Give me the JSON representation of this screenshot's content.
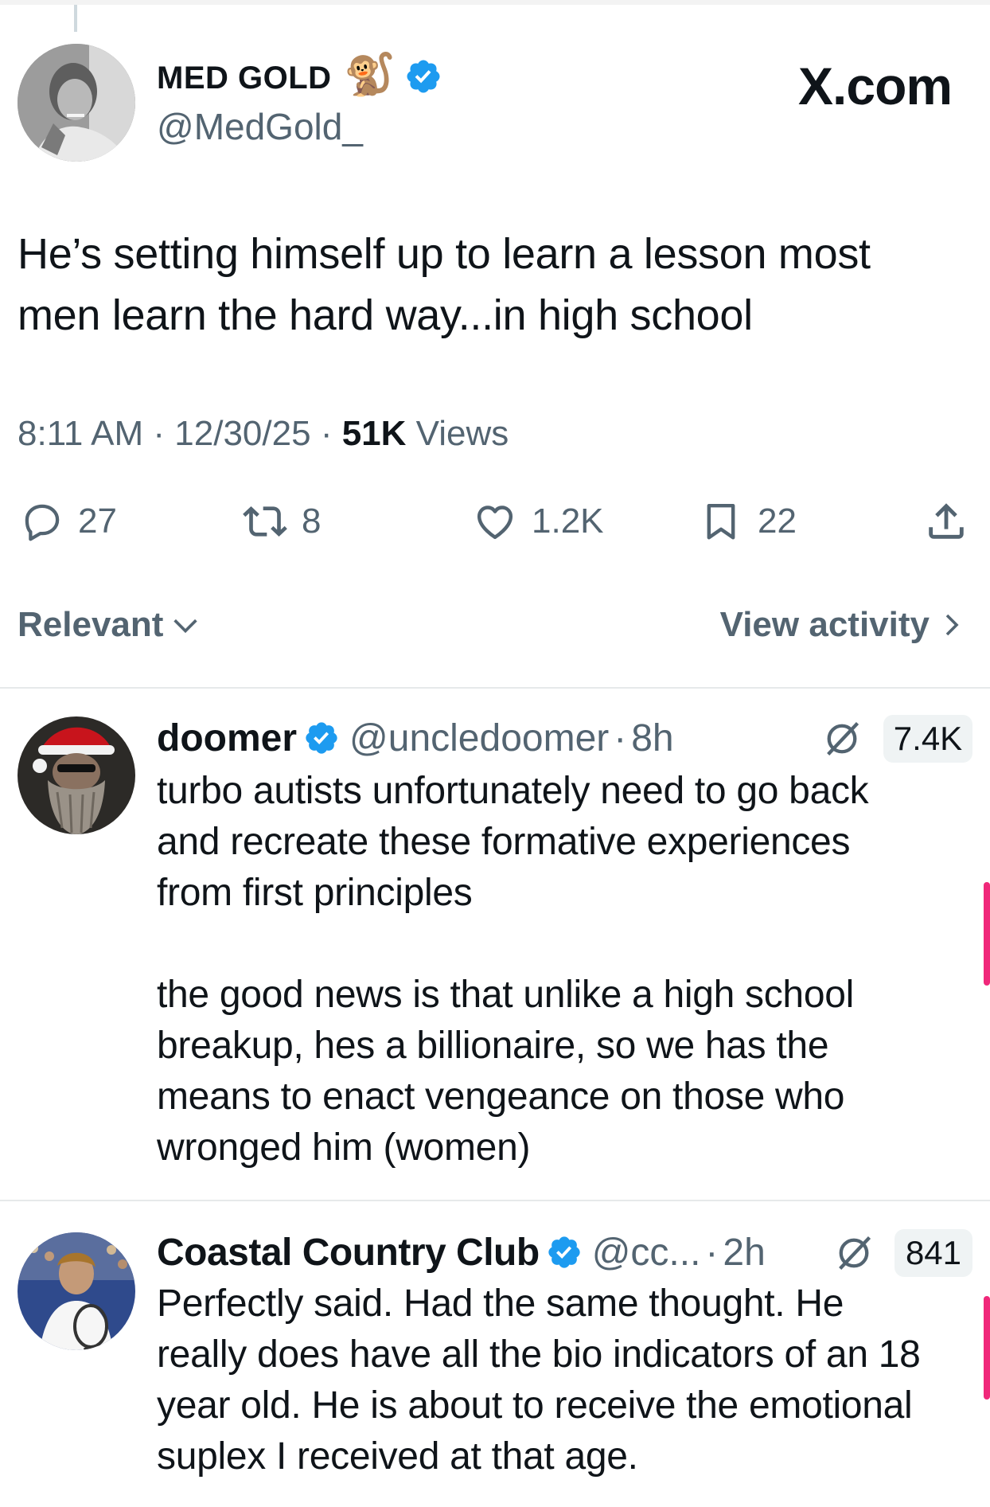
{
  "watermark": "X.com",
  "post": {
    "author": {
      "name": "MED GOLD",
      "emoji": "🐒",
      "handle": "@MedGold_",
      "avatar": "avatar-man-smoking"
    },
    "text_line1": "He’s setting himself up to learn a lesson most",
    "text_line2": "men learn the hard way...in high school",
    "time": "8:11 AM",
    "date": "12/30/25",
    "separator": "·",
    "views_count": "51K",
    "views_label": "Views",
    "actions": {
      "replies": "27",
      "reposts": "8",
      "likes": "1.2K",
      "bookmarks": "22"
    }
  },
  "sort": {
    "label": "Relevant",
    "activity_label": "View activity"
  },
  "replies": [
    {
      "name": "doomer",
      "handle": "@uncledoomer",
      "time": "8h",
      "views": "7.4K",
      "avatar": "avatar-santa-hat",
      "lines": [
        "turbo autists unfortunately need to go back",
        "and recreate these formative experiences",
        "from first principles",
        "",
        "the good news is that unlike a high school",
        "breakup, hes a billionaire, so we has the",
        "means to enact vengeance on those who",
        "wronged him (women)"
      ]
    },
    {
      "name": "Coastal Country Club",
      "handle": "@cc...",
      "time": "2h",
      "views": "841",
      "avatar": "avatar-tennis-player",
      "lines": [
        "Perfectly said.  Had the same thought.  He",
        "really does have all the bio indicators of an 18",
        "year old.  He is about to receive the emotional",
        "suplex I received at that age."
      ]
    }
  ],
  "colors": {
    "text": "#0f1419",
    "muted": "#536471",
    "verified": "#1d9bf0",
    "divider": "#e6e9ea",
    "scroll_marker": "#f0287a"
  }
}
